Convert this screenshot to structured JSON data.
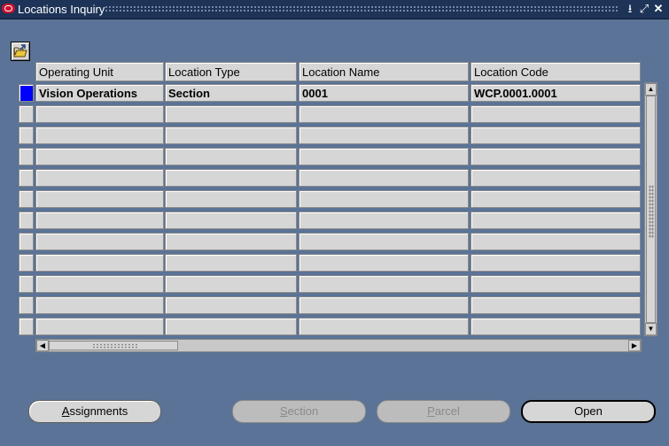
{
  "window": {
    "title": "Locations Inquiry",
    "minimize_glyph": "⭳",
    "maximize_glyph": "⤢",
    "close_glyph": "✕"
  },
  "toolbar": {
    "folder_icon": "folder-open-icon"
  },
  "table": {
    "columns": [
      "Operating Unit",
      "Location Type",
      "Location Name",
      "Location Code"
    ],
    "rows": [
      [
        "Vision Operations",
        "Section",
        "0001",
        "WCP.0001.0001"
      ],
      [
        "",
        "",
        "",
        ""
      ],
      [
        "",
        "",
        "",
        ""
      ],
      [
        "",
        "",
        "",
        ""
      ],
      [
        "",
        "",
        "",
        ""
      ],
      [
        "",
        "",
        "",
        ""
      ],
      [
        "",
        "",
        "",
        ""
      ],
      [
        "",
        "",
        "",
        ""
      ],
      [
        "",
        "",
        "",
        ""
      ],
      [
        "",
        "",
        "",
        ""
      ],
      [
        "",
        "",
        "",
        ""
      ],
      [
        "",
        "",
        "",
        ""
      ]
    ],
    "current_row_color": "#0000ff"
  },
  "buttons": {
    "assignments": {
      "label": "Assignments",
      "enabled": true
    },
    "section": {
      "label": "Section",
      "enabled": false
    },
    "parcel": {
      "label": "Parcel",
      "enabled": false
    },
    "open": {
      "label": "Open",
      "enabled": true
    }
  },
  "colors": {
    "background": "#5b7396",
    "titlebar": "#1d3357",
    "field": "#d6d6d6"
  }
}
